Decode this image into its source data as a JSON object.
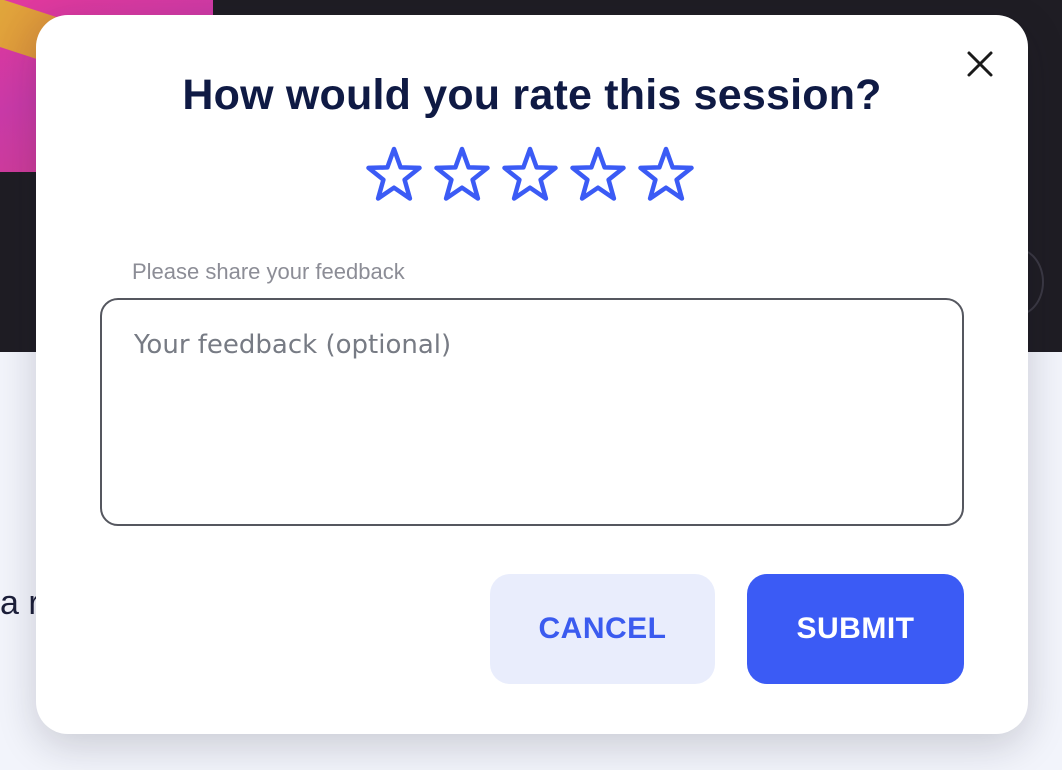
{
  "background": {
    "partial_text": "a r"
  },
  "modal": {
    "title": "How would you rate this session?",
    "close_icon": "close-icon",
    "rating": {
      "max": 5,
      "value": 0,
      "icon": "star-icon",
      "color": "#3b5bf5"
    },
    "feedback": {
      "label": "Please share your feedback",
      "placeholder": "Your feedback (optional)",
      "value": ""
    },
    "buttons": {
      "cancel_label": "CANCEL",
      "submit_label": "SUBMIT"
    }
  },
  "colors": {
    "accent": "#3b5bf5",
    "title": "#0f1a44",
    "cancel_bg": "#e9edfc"
  }
}
